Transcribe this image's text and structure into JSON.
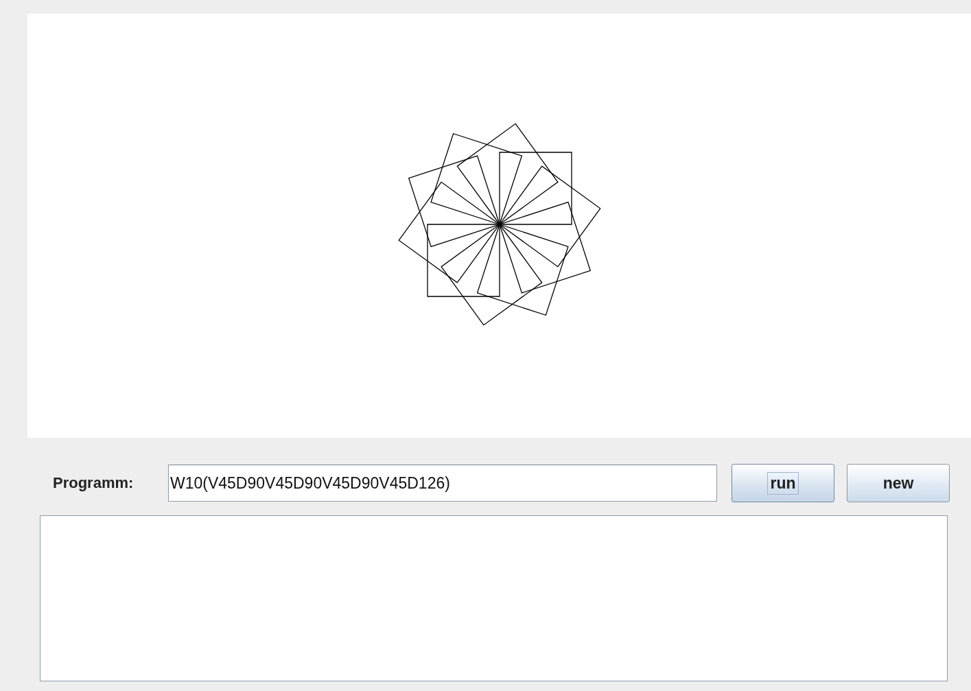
{
  "program": {
    "label": "Programm:",
    "value": "W10(V45D90V45D90V45D90V45D126)"
  },
  "buttons": [
    {
      "label": "run",
      "focused": true
    },
    {
      "label": "new",
      "focused": false
    }
  ]
}
